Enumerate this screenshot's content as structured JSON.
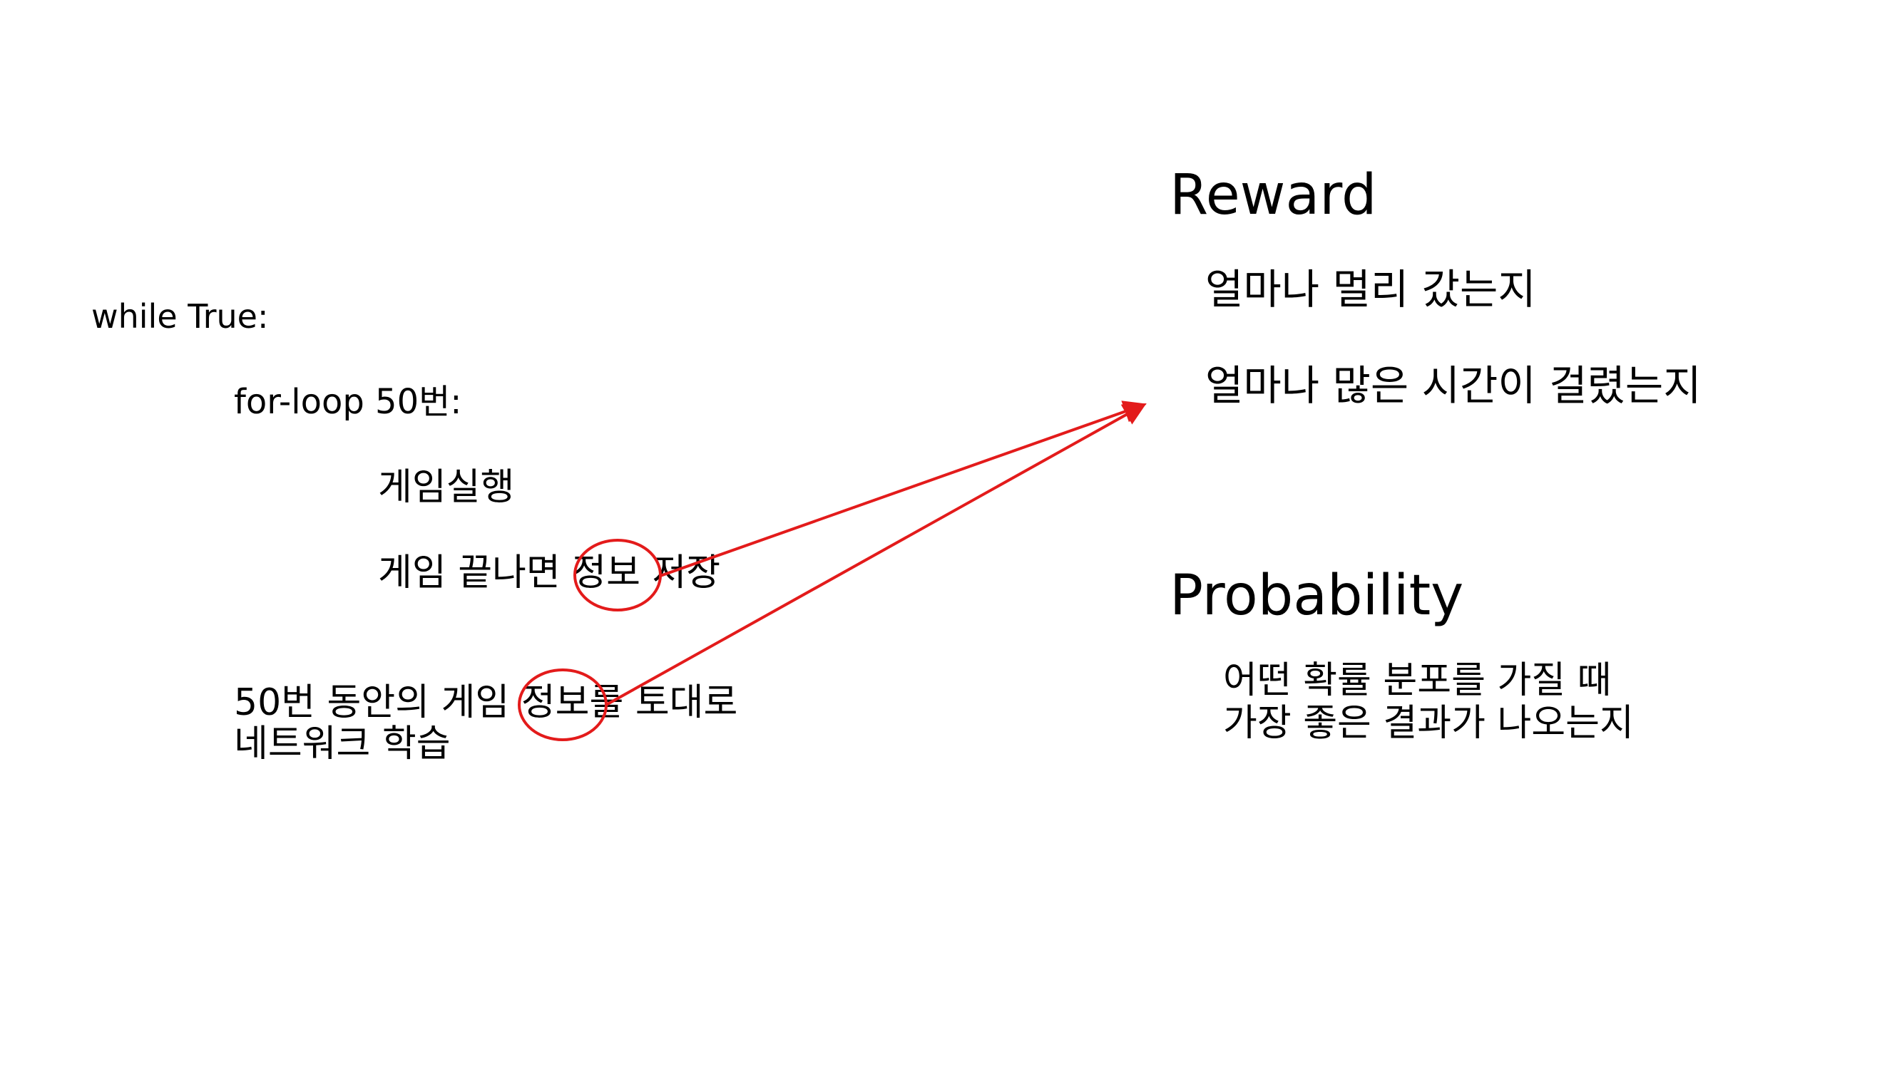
{
  "code": {
    "while_line": "while True:",
    "for_line": "for-loop 50번:",
    "run_line": "게임실행",
    "save_line": "게임 끝나면 정보 저장",
    "train_line_1": "50번 동안의 게임 정보를 토대로",
    "train_line_2": "네트워크 학습"
  },
  "reward": {
    "heading": "Reward",
    "items": [
      "얼마나 멀리 갔는지",
      "얼마나 많은 시간이 걸렸는지"
    ]
  },
  "probability": {
    "heading": "Probability",
    "line_1": "어떤 확률 분포를 가질 때",
    "line_2": "가장 좋은 결과가 나오는지"
  },
  "annotation": {
    "circle_color": "#e31b1b",
    "arrow_color": "#e31b1b"
  }
}
